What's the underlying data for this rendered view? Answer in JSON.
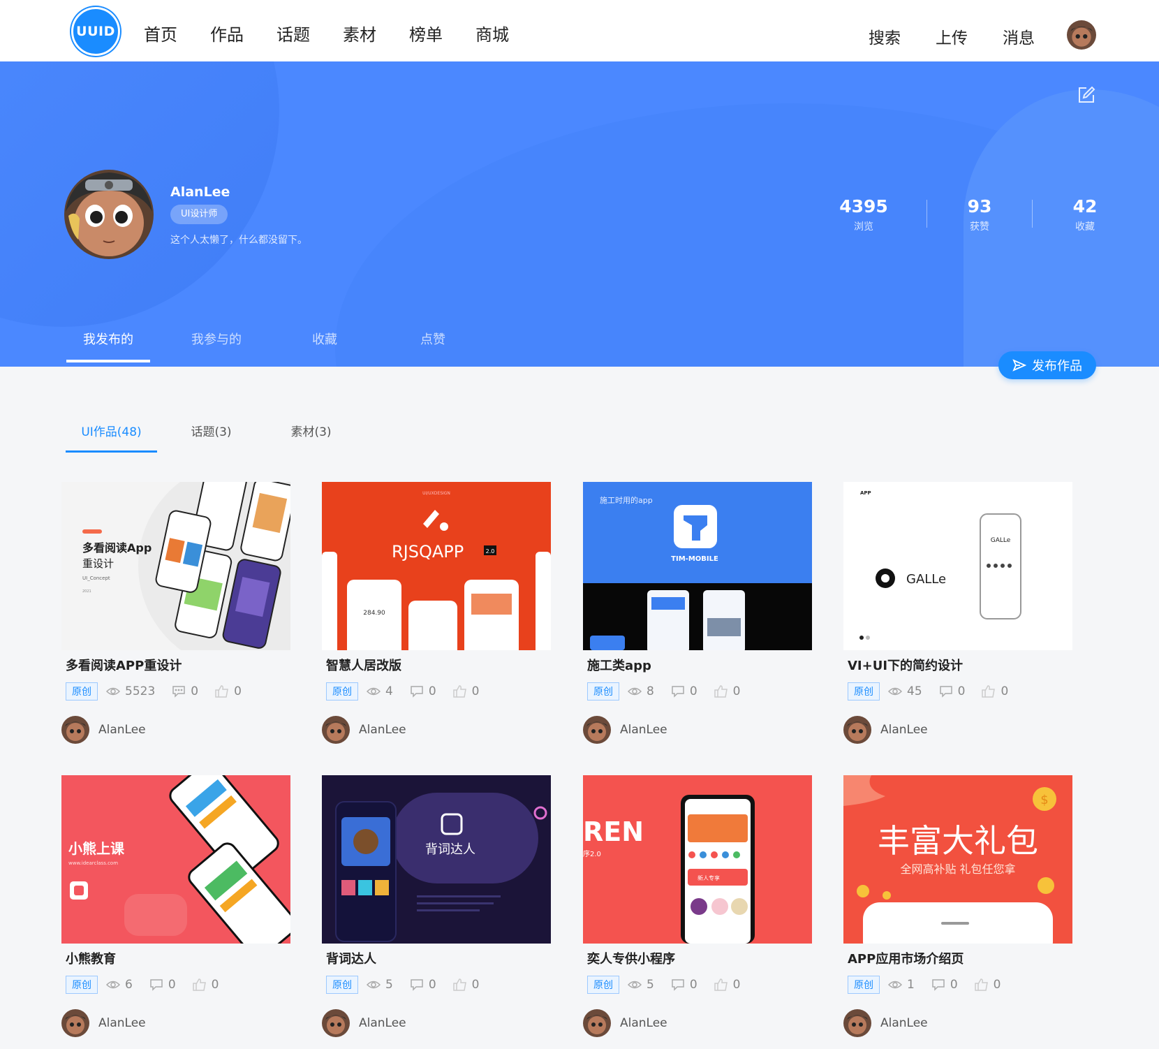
{
  "logo": "UUID",
  "nav": {
    "left": [
      "首页",
      "作品",
      "话题",
      "素材",
      "榜单",
      "商城"
    ],
    "right": [
      "搜索",
      "上传",
      "消息"
    ]
  },
  "profile": {
    "name": "AlanLee",
    "tag": "UI设计师",
    "bio": "这个人太懒了，什么都没留下。",
    "stats": [
      {
        "num": "4395",
        "label": "浏览"
      },
      {
        "num": "93",
        "label": "获赞"
      },
      {
        "num": "42",
        "label": "收藏"
      }
    ]
  },
  "profile_tabs": [
    "我发布的",
    "我参与的",
    "收藏",
    "点赞"
  ],
  "publish_label": "发布作品",
  "content_tabs": [
    "UI作品(48)",
    "话题(3)",
    "素材(3)"
  ],
  "cards": [
    {
      "title": "多看阅读APP重设计",
      "badge": "原创",
      "views": "5523",
      "comments": "0",
      "likes": "0",
      "author": "AlanLee",
      "thumb_bg": "#f4f4f4",
      "thumb_texts": {
        "a": "多看阅读App",
        "b": "重设计",
        "c": "UI_Concept",
        "d": "2021"
      }
    },
    {
      "title": "智慧人居改版",
      "badge": "原创",
      "views": "4",
      "comments": "0",
      "likes": "0",
      "author": "AlanLee",
      "thumb_bg": "#e8411c",
      "thumb_texts": {
        "a": "RJSQAPP",
        "b": "2.0",
        "c": "UI/UXDESIGN",
        "d": "284.90"
      }
    },
    {
      "title": "施工类app",
      "badge": "原创",
      "views": "8",
      "comments": "0",
      "likes": "0",
      "author": "AlanLee",
      "thumb_bg": "#3b7ff0",
      "thumb_texts": {
        "a": "施工时用的app",
        "b": "TIM-MOBILE"
      }
    },
    {
      "title": "VI+UI下的简约设计",
      "badge": "原创",
      "views": "45",
      "comments": "0",
      "likes": "0",
      "author": "AlanLee",
      "thumb_bg": "#ffffff",
      "thumb_texts": {
        "a": "GALLe",
        "b": "APP",
        "c": "GALLe"
      }
    },
    {
      "title": "小熊教育",
      "badge": "原创",
      "views": "6",
      "comments": "0",
      "likes": "0",
      "author": "AlanLee",
      "thumb_bg": "#f3565e",
      "thumb_texts": {
        "a": "小熊上课",
        "b": "www.idearclass.com"
      }
    },
    {
      "title": "背词达人",
      "badge": "原创",
      "views": "5",
      "comments": "0",
      "likes": "0",
      "author": "AlanLee",
      "thumb_bg": "#1b1438",
      "thumb_texts": {
        "a": "背词达人"
      }
    },
    {
      "title": "奕人专供小程序",
      "badge": "原创",
      "views": "5",
      "comments": "0",
      "likes": "0",
      "author": "AlanLee",
      "thumb_bg": "#f4534f",
      "thumb_texts": {
        "a": "REN",
        "b": "序2.0",
        "c": "新人专享"
      }
    },
    {
      "title": "APP应用市场介绍页",
      "badge": "原创",
      "views": "1",
      "comments": "0",
      "likes": "0",
      "author": "AlanLee",
      "thumb_bg": "#f2513f",
      "thumb_texts": {
        "a": "丰富大礼包",
        "b": "全网高补贴  礼包任您拿"
      }
    }
  ],
  "colors": {
    "brand": "#1a8cff",
    "banner": "#4b88ff"
  }
}
